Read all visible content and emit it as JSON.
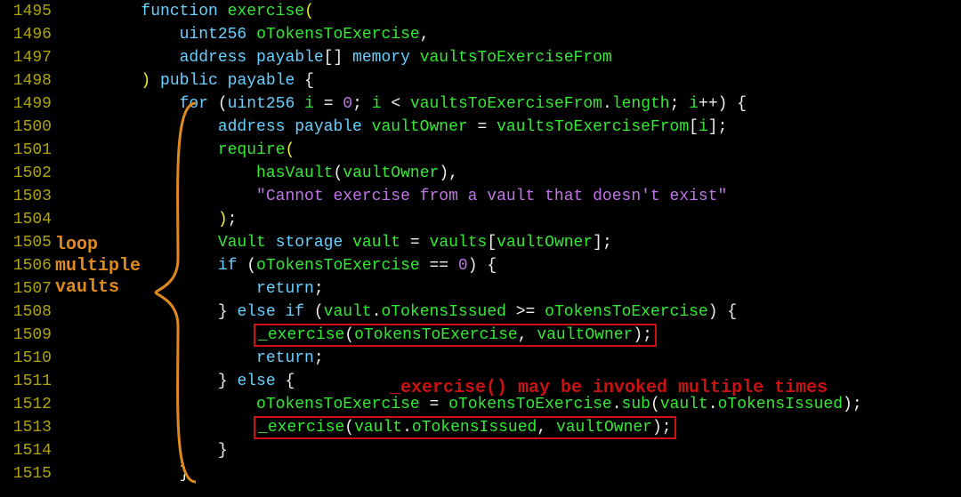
{
  "lines": [
    {
      "num": "1495",
      "tokens": [
        {
          "t": "        ",
          "c": ""
        },
        {
          "t": "function",
          "c": "kw"
        },
        {
          "t": " ",
          "c": ""
        },
        {
          "t": "exercise",
          "c": "fn"
        },
        {
          "t": "(",
          "c": "yellow"
        }
      ]
    },
    {
      "num": "1496",
      "tokens": [
        {
          "t": "            ",
          "c": ""
        },
        {
          "t": "uint256",
          "c": "kw"
        },
        {
          "t": " ",
          "c": ""
        },
        {
          "t": "oTokensToExercise",
          "c": "fn"
        },
        {
          "t": ",",
          "c": ""
        }
      ]
    },
    {
      "num": "1497",
      "tokens": [
        {
          "t": "            ",
          "c": ""
        },
        {
          "t": "address payable",
          "c": "kw"
        },
        {
          "t": "[] ",
          "c": ""
        },
        {
          "t": "memory",
          "c": "kw"
        },
        {
          "t": " ",
          "c": ""
        },
        {
          "t": "vaultsToExerciseFrom",
          "c": "fn"
        }
      ]
    },
    {
      "num": "1498",
      "tokens": [
        {
          "t": "        ",
          "c": ""
        },
        {
          "t": ")",
          "c": "yellow"
        },
        {
          "t": " ",
          "c": ""
        },
        {
          "t": "public payable",
          "c": "kw"
        },
        {
          "t": " {",
          "c": ""
        }
      ]
    },
    {
      "num": "1499",
      "tokens": [
        {
          "t": "            ",
          "c": ""
        },
        {
          "t": "for",
          "c": "kw"
        },
        {
          "t": " (",
          "c": ""
        },
        {
          "t": "uint256",
          "c": "kw"
        },
        {
          "t": " ",
          "c": ""
        },
        {
          "t": "i",
          "c": "fn"
        },
        {
          "t": " = ",
          "c": ""
        },
        {
          "t": "0",
          "c": "num"
        },
        {
          "t": "; ",
          "c": ""
        },
        {
          "t": "i",
          "c": "fn"
        },
        {
          "t": " < ",
          "c": ""
        },
        {
          "t": "vaultsToExerciseFrom",
          "c": "fn"
        },
        {
          "t": ".",
          "c": ""
        },
        {
          "t": "length",
          "c": "fn"
        },
        {
          "t": "; ",
          "c": ""
        },
        {
          "t": "i",
          "c": "fn"
        },
        {
          "t": "++) {",
          "c": ""
        }
      ]
    },
    {
      "num": "1500",
      "tokens": [
        {
          "t": "                ",
          "c": ""
        },
        {
          "t": "address payable",
          "c": "kw"
        },
        {
          "t": " ",
          "c": ""
        },
        {
          "t": "vaultOwner",
          "c": "fn"
        },
        {
          "t": " = ",
          "c": ""
        },
        {
          "t": "vaultsToExerciseFrom",
          "c": "fn"
        },
        {
          "t": "[",
          "c": ""
        },
        {
          "t": "i",
          "c": "fn"
        },
        {
          "t": "];",
          "c": ""
        }
      ]
    },
    {
      "num": "1501",
      "tokens": [
        {
          "t": "                ",
          "c": ""
        },
        {
          "t": "require",
          "c": "fn"
        },
        {
          "t": "(",
          "c": "yellow"
        }
      ]
    },
    {
      "num": "1502",
      "tokens": [
        {
          "t": "                    ",
          "c": ""
        },
        {
          "t": "hasVault",
          "c": "fn"
        },
        {
          "t": "(",
          "c": ""
        },
        {
          "t": "vaultOwner",
          "c": "fn"
        },
        {
          "t": "),",
          "c": ""
        }
      ]
    },
    {
      "num": "1503",
      "tokens": [
        {
          "t": "                    ",
          "c": ""
        },
        {
          "t": "\"Cannot exercise from a vault that doesn't exist\"",
          "c": "str"
        }
      ]
    },
    {
      "num": "1504",
      "tokens": [
        {
          "t": "                ",
          "c": ""
        },
        {
          "t": ")",
          "c": "yellow"
        },
        {
          "t": ";",
          "c": ""
        }
      ]
    },
    {
      "num": "1505",
      "tokens": [
        {
          "t": "                ",
          "c": ""
        },
        {
          "t": "Vault",
          "c": "fn"
        },
        {
          "t": " ",
          "c": ""
        },
        {
          "t": "storage",
          "c": "kw"
        },
        {
          "t": " ",
          "c": ""
        },
        {
          "t": "vault",
          "c": "fn"
        },
        {
          "t": " = ",
          "c": ""
        },
        {
          "t": "vaults",
          "c": "fn"
        },
        {
          "t": "[",
          "c": ""
        },
        {
          "t": "vaultOwner",
          "c": "fn"
        },
        {
          "t": "];",
          "c": ""
        }
      ]
    },
    {
      "num": "1506",
      "tokens": [
        {
          "t": "                ",
          "c": ""
        },
        {
          "t": "if",
          "c": "kw"
        },
        {
          "t": " (",
          "c": ""
        },
        {
          "t": "oTokensToExercise",
          "c": "fn"
        },
        {
          "t": " == ",
          "c": ""
        },
        {
          "t": "0",
          "c": "num"
        },
        {
          "t": ") {",
          "c": ""
        }
      ]
    },
    {
      "num": "1507",
      "tokens": [
        {
          "t": "                    ",
          "c": ""
        },
        {
          "t": "return",
          "c": "kw"
        },
        {
          "t": ";",
          "c": ""
        }
      ]
    },
    {
      "num": "1508",
      "tokens": [
        {
          "t": "                } ",
          "c": ""
        },
        {
          "t": "else if",
          "c": "kw"
        },
        {
          "t": " (",
          "c": ""
        },
        {
          "t": "vault",
          "c": "fn"
        },
        {
          "t": ".",
          "c": ""
        },
        {
          "t": "oTokensIssued",
          "c": "fn"
        },
        {
          "t": " >= ",
          "c": ""
        },
        {
          "t": "oTokensToExercise",
          "c": "fn"
        },
        {
          "t": ") {",
          "c": ""
        }
      ]
    },
    {
      "num": "1509",
      "tokens": [
        {
          "t": "                    ",
          "c": ""
        },
        {
          "t": "_exercise",
          "c": "fn",
          "box": true
        },
        {
          "t": "(",
          "c": "",
          "box": true
        },
        {
          "t": "oTokensToExercise",
          "c": "fn",
          "box": true
        },
        {
          "t": ", ",
          "c": "",
          "box": true
        },
        {
          "t": "vaultOwner",
          "c": "fn",
          "box": true
        },
        {
          "t": ");",
          "c": "",
          "box": true
        }
      ]
    },
    {
      "num": "1510",
      "tokens": [
        {
          "t": "                    ",
          "c": ""
        },
        {
          "t": "return",
          "c": "kw"
        },
        {
          "t": ";",
          "c": ""
        }
      ]
    },
    {
      "num": "1511",
      "tokens": [
        {
          "t": "                } ",
          "c": ""
        },
        {
          "t": "else",
          "c": "kw"
        },
        {
          "t": " {",
          "c": ""
        }
      ]
    },
    {
      "num": "1512",
      "tokens": [
        {
          "t": "                    ",
          "c": ""
        },
        {
          "t": "oTokensToExercise",
          "c": "fn"
        },
        {
          "t": " = ",
          "c": ""
        },
        {
          "t": "oTokensToExercise",
          "c": "fn"
        },
        {
          "t": ".",
          "c": ""
        },
        {
          "t": "sub",
          "c": "fn"
        },
        {
          "t": "(",
          "c": ""
        },
        {
          "t": "vault",
          "c": "fn"
        },
        {
          "t": ".",
          "c": ""
        },
        {
          "t": "oTokensIssued",
          "c": "fn"
        },
        {
          "t": ");",
          "c": ""
        }
      ]
    },
    {
      "num": "1513",
      "tokens": [
        {
          "t": "                    ",
          "c": ""
        },
        {
          "t": "_exercise",
          "c": "fn",
          "box": true
        },
        {
          "t": "(",
          "c": "",
          "box": true
        },
        {
          "t": "vault",
          "c": "fn",
          "box": true
        },
        {
          "t": ".",
          "c": "",
          "box": true
        },
        {
          "t": "oTokensIssued",
          "c": "fn",
          "box": true
        },
        {
          "t": ", ",
          "c": "",
          "box": true
        },
        {
          "t": "vaultOwner",
          "c": "fn",
          "box": true
        },
        {
          "t": ");",
          "c": "",
          "box": true
        }
      ]
    },
    {
      "num": "1514",
      "tokens": [
        {
          "t": "                }",
          "c": ""
        }
      ]
    },
    {
      "num": "1515",
      "tokens": [
        {
          "t": "            }",
          "c": ""
        }
      ]
    }
  ],
  "annotation_left": [
    "loop",
    "multiple",
    "vaults"
  ],
  "annotation_right": "_exercise() may be invoked multiple times"
}
